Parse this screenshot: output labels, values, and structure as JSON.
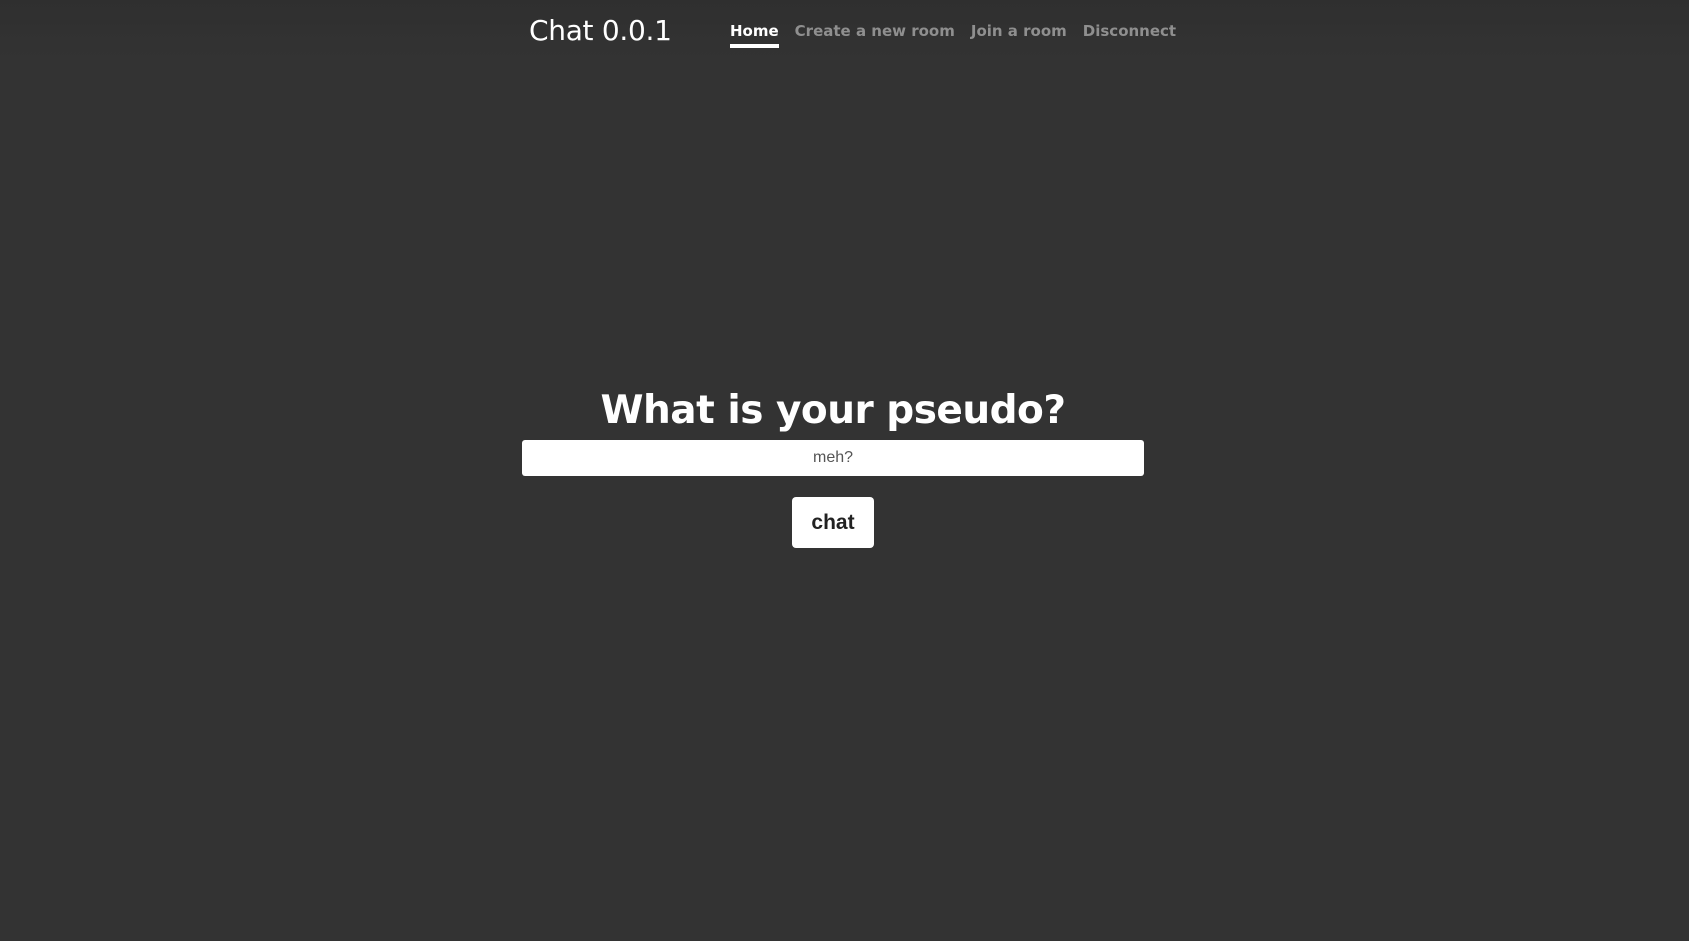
{
  "header": {
    "brand": "Chat 0.0.1",
    "nav": [
      {
        "label": "Home",
        "active": true
      },
      {
        "label": "Create a new room",
        "active": false
      },
      {
        "label": "Join a room",
        "active": false
      },
      {
        "label": "Disconnect",
        "active": false
      }
    ]
  },
  "main": {
    "question": "What is your pseudo?",
    "pseudo_input": {
      "value": "",
      "placeholder": "meh?"
    },
    "submit_label": "chat"
  },
  "colors": {
    "background": "#333333",
    "text": "#ffffff",
    "nav_inactive": "#8f8f8f",
    "button_bg": "#ffffff"
  }
}
